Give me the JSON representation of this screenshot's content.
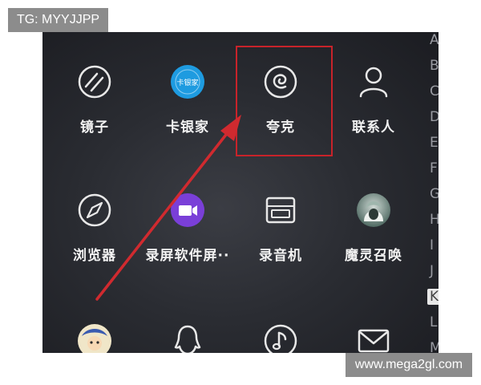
{
  "watermarks": {
    "top_left": "TG: MYYJJPP",
    "bottom_right": "www.mega2gl.com"
  },
  "apps": [
    {
      "label": "镜子",
      "icon": "mirror-icon"
    },
    {
      "label": "卡银家",
      "icon": "kayinjia-icon",
      "icon_text": "卡银家"
    },
    {
      "label": "夸克",
      "icon": "quark-icon"
    },
    {
      "label": "联系人",
      "icon": "contacts-icon"
    },
    {
      "label": "浏览器",
      "icon": "browser-icon"
    },
    {
      "label": "录屏软件屏··",
      "icon": "screen-recorder-icon"
    },
    {
      "label": "录音机",
      "icon": "recorder-icon"
    },
    {
      "label": "魔灵召唤",
      "icon": "summoners-war-icon"
    },
    {
      "label": "",
      "icon": "game-avatar-icon"
    },
    {
      "label": "",
      "icon": "qq-icon"
    },
    {
      "label": "",
      "icon": "music-icon"
    },
    {
      "label": "",
      "icon": "mail-icon"
    }
  ],
  "alphabet_index": [
    "A",
    "B",
    "C",
    "D",
    "E",
    "F",
    "G",
    "H",
    "I",
    "J",
    "K",
    "L",
    "M"
  ],
  "alphabet_active": "K",
  "colors": {
    "highlight": "#c8232a",
    "kayinjia_blue": "#1e9be0",
    "recorder_purple": "#7a3fd8"
  }
}
